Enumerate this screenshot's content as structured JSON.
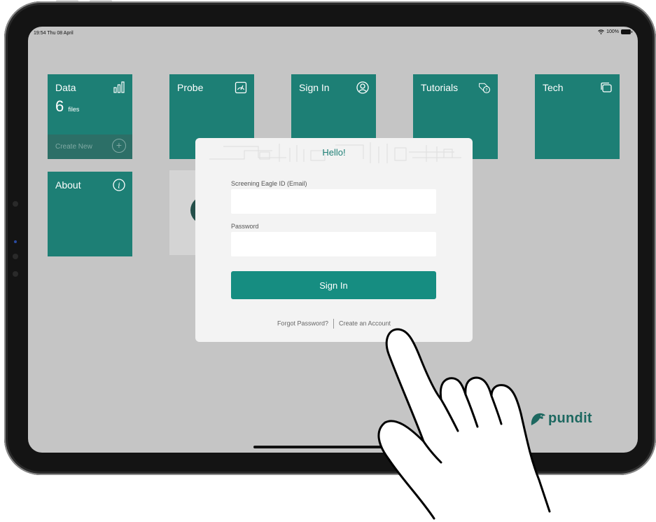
{
  "status_bar": {
    "time": "19:54 Thu 08 April",
    "battery": "100%"
  },
  "tiles": {
    "data": {
      "title": "Data",
      "count": "6",
      "unit": "files",
      "create_label": "Create New",
      "icon": "bar-chart-icon"
    },
    "probe": {
      "title": "Probe",
      "icon": "gauge-icon"
    },
    "signin": {
      "title": "Sign In",
      "icon": "user-circle-icon"
    },
    "tutorials": {
      "title": "Tutorials",
      "icon": "help-tag-icon"
    },
    "tech": {
      "title": "Tech",
      "icon": "windows-icon"
    },
    "about": {
      "title": "About",
      "icon": "info-icon"
    }
  },
  "modal": {
    "title": "Hello!",
    "email_label": "Screening Eagle ID (Email)",
    "email_value": "",
    "password_label": "Password",
    "password_value": "",
    "signin_button": "Sign In",
    "forgot_link": "Forgot Password?",
    "create_link": "Create an Account"
  },
  "logo": {
    "text": "pundit",
    "icon": "eagle-icon"
  },
  "colors": {
    "tile": "#1d7f75",
    "button": "#168d81",
    "logo": "#1d6860",
    "screen": "#c5c5c5"
  }
}
